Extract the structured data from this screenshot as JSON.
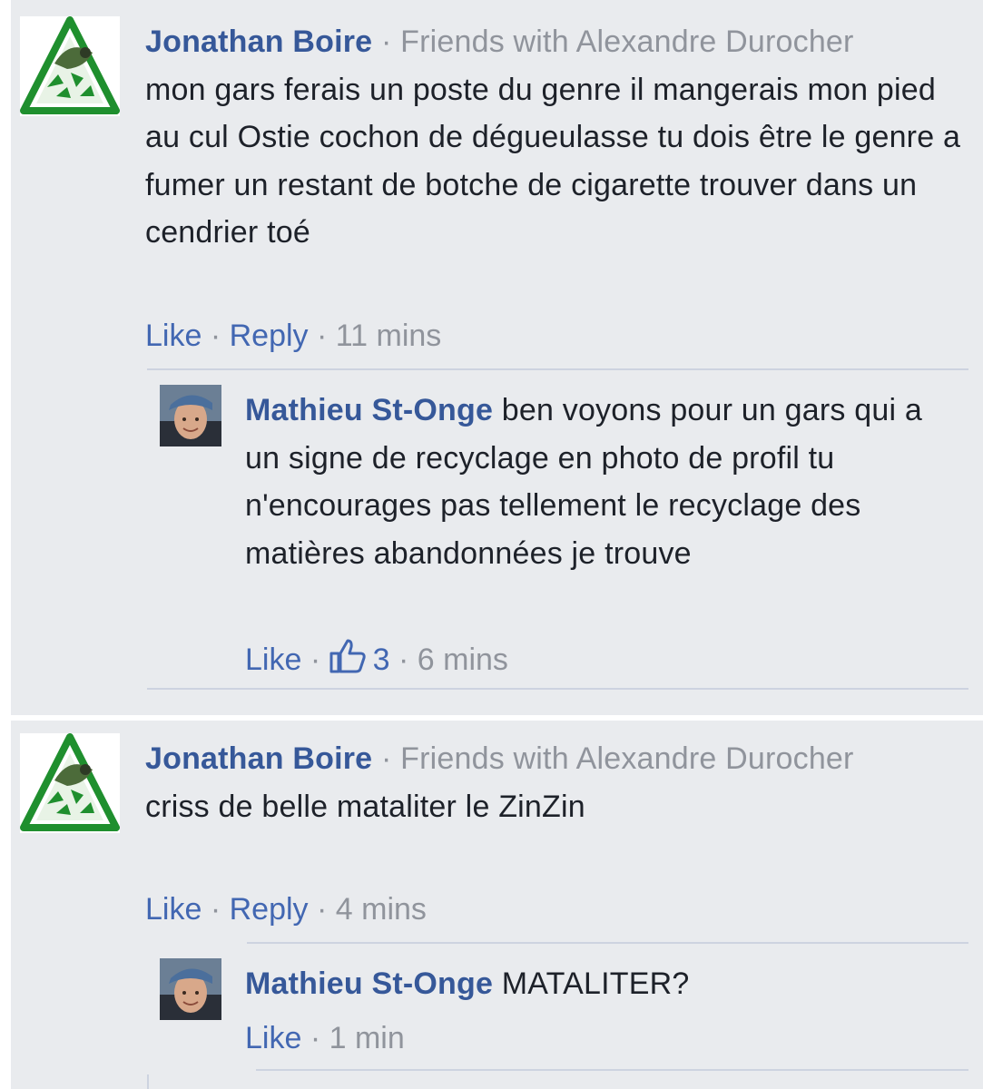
{
  "comments": [
    {
      "author": "Jonathan Boire",
      "separator": "·",
      "context": "Friends with Alexandre Durocher",
      "text": "mon gars ferais un poste du genre il mangerais mon pied au cul Ostie cochon de dégueulasse tu dois être le genre a fumer un restant de botche de cigarette trouver dans un cendrier toé",
      "like_label": "Like",
      "reply_label": "Reply",
      "time": "11 mins",
      "avatar_icon": "recycle-frog-icon",
      "reply": {
        "author": "Mathieu St-Onge",
        "text": "ben voyons pour un gars qui a un signe de recyclage en photo de profil tu n'encourages pas tellement le recyclage des matières abandonnées je trouve",
        "like_label": "Like",
        "likes_count": "3",
        "likes_icon": "thumbs-up-icon",
        "time": "6 mins"
      }
    },
    {
      "author": "Jonathan Boire",
      "separator": "·",
      "context": "Friends with Alexandre Durocher",
      "text": "criss de belle mataliter le ZinZin",
      "like_label": "Like",
      "reply_label": "Reply",
      "time": "4 mins",
      "avatar_icon": "recycle-frog-icon",
      "reply": {
        "author": "Mathieu St-Onge",
        "text": "MATALITER?",
        "like_label": "Like",
        "time": "1 min"
      }
    }
  ],
  "dot": "·",
  "colors": {
    "background": "#e9ebee",
    "author": "#365899",
    "link": "#4267b2",
    "meta": "#90949c",
    "text": "#1d2129",
    "divider": "#cdd3e0"
  }
}
